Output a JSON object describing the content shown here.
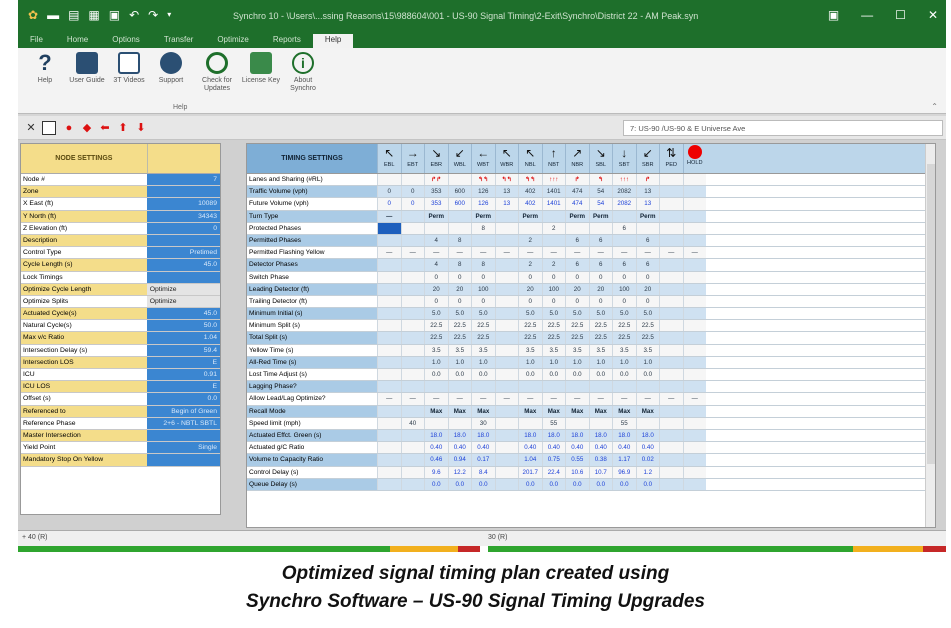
{
  "window": {
    "title": "Synchro 10 - \\Users\\...ssing Reasons\\15\\988604\\001 - US-90 Signal Timing\\2-Exit\\Synchro\\District 22 - AM Peak.syn"
  },
  "ribbon": {
    "tabs": [
      "File",
      "Home",
      "Options",
      "Transfer",
      "Optimize",
      "Reports",
      "Help"
    ],
    "buttons": [
      "Help",
      "User Guide",
      "3T Videos",
      "Support",
      "Check for Updates",
      "License Key",
      "About Synchro"
    ],
    "group_label": "Help"
  },
  "toolbar": {
    "node_selector": "7: US-90 /US-90 & E Universe Ave"
  },
  "node_panel": {
    "header": "NODE SETTINGS",
    "rows": [
      {
        "label": "Node #",
        "value": "7"
      },
      {
        "label": "Zone",
        "value": ""
      },
      {
        "label": "X East (ft)",
        "value": "10089"
      },
      {
        "label": "Y North (ft)",
        "value": "34343"
      },
      {
        "label": "Z Elevation (ft)",
        "value": "0"
      },
      {
        "label": "Description",
        "value": ""
      },
      {
        "label": "Control Type",
        "value": "Pretimed"
      },
      {
        "label": "Cycle Length (s)",
        "value": "45.0"
      },
      {
        "label": "Lock Timings",
        "value": ""
      },
      {
        "label": "Optimize Cycle Length",
        "value": "Optimize"
      },
      {
        "label": "Optimize Splits",
        "value": "Optimize"
      },
      {
        "label": "Actuated Cycle(s)",
        "value": "45.0"
      },
      {
        "label": "Natural Cycle(s)",
        "value": "50.0"
      },
      {
        "label": "Max v/c Ratio",
        "value": "1.04"
      },
      {
        "label": "Intersection Delay (s)",
        "value": "59.4"
      },
      {
        "label": "Intersection LOS",
        "value": "E"
      },
      {
        "label": "ICU",
        "value": "0.91"
      },
      {
        "label": "ICU LOS",
        "value": "E"
      },
      {
        "label": "Offset (s)",
        "value": "0.0"
      },
      {
        "label": "Referenced to",
        "value": "Begin of Green"
      },
      {
        "label": "Reference Phase",
        "value": "2+6 - NBTL SBTL"
      },
      {
        "label": "Master Intersection",
        "value": ""
      },
      {
        "label": "Yield Point",
        "value": "Single"
      },
      {
        "label": "Mandatory Stop On Yellow",
        "value": ""
      }
    ]
  },
  "timing_panel": {
    "header": "TIMING SETTINGS",
    "movements": [
      {
        "label": "EBL",
        "arrow": "↖"
      },
      {
        "label": "EBT",
        "arrow": "→"
      },
      {
        "label": "EBR",
        "arrow": "↘"
      },
      {
        "label": "WBL",
        "arrow": "↙"
      },
      {
        "label": "WBT",
        "arrow": "←"
      },
      {
        "label": "WBR",
        "arrow": "↖"
      },
      {
        "label": "NBL",
        "arrow": "↖"
      },
      {
        "label": "NBT",
        "arrow": "↑"
      },
      {
        "label": "NBR",
        "arrow": "↗"
      },
      {
        "label": "SBL",
        "arrow": "↘"
      },
      {
        "label": "SBT",
        "arrow": "↓"
      },
      {
        "label": "SBR",
        "arrow": "↙"
      },
      {
        "label": "PED",
        "arrow": "⇅"
      },
      {
        "label": "HOLD",
        "arrow": ""
      }
    ],
    "rows": [
      {
        "label": "Lanes and Sharing (#RL)",
        "values": [
          "",
          "",
          "↱↱",
          "",
          "↰↰",
          "↰↰",
          "↰↰",
          "↑↑↑",
          "↱",
          "↰",
          "↑↑↑",
          "↱",
          "",
          ""
        ]
      },
      {
        "label": "Traffic Volume (vph)",
        "values": [
          "0",
          "0",
          "353",
          "600",
          "126",
          "13",
          "402",
          "1401",
          "474",
          "54",
          "2082",
          "13",
          "",
          ""
        ]
      },
      {
        "label": "Future Volume (vph)",
        "values": [
          "0",
          "0",
          "353",
          "600",
          "126",
          "13",
          "402",
          "1401",
          "474",
          "54",
          "2082",
          "13",
          "",
          ""
        ]
      },
      {
        "label": "Turn Type",
        "values": [
          "—",
          "",
          "Perm",
          "",
          "Perm",
          "",
          "Perm",
          "",
          "Perm",
          "Perm",
          "",
          "Perm",
          "",
          ""
        ]
      },
      {
        "label": "Protected Phases",
        "values": [
          "",
          "",
          "",
          "",
          "8",
          "",
          "",
          "2",
          "",
          "",
          "6",
          "",
          "",
          ""
        ]
      },
      {
        "label": "Permitted Phases",
        "values": [
          "",
          "",
          "4",
          "8",
          "",
          "",
          "2",
          "",
          "6",
          "6",
          "",
          "6",
          "",
          ""
        ]
      },
      {
        "label": "Permitted Flashing Yellow",
        "values": [
          "—",
          "—",
          "—",
          "—",
          "—",
          "—",
          "—",
          "—",
          "—",
          "—",
          "—",
          "—",
          "—",
          "—"
        ]
      },
      {
        "label": "Detector Phases",
        "values": [
          "",
          "",
          "4",
          "8",
          "8",
          "",
          "2",
          "2",
          "6",
          "6",
          "6",
          "6",
          "",
          ""
        ]
      },
      {
        "label": "Switch Phase",
        "values": [
          "",
          "",
          "0",
          "0",
          "0",
          "",
          "0",
          "0",
          "0",
          "0",
          "0",
          "0",
          "",
          ""
        ]
      },
      {
        "label": "Leading Detector (ft)",
        "values": [
          "",
          "",
          "20",
          "20",
          "100",
          "",
          "20",
          "100",
          "20",
          "20",
          "100",
          "20",
          "",
          ""
        ]
      },
      {
        "label": "Trailing Detector (ft)",
        "values": [
          "",
          "",
          "0",
          "0",
          "0",
          "",
          "0",
          "0",
          "0",
          "0",
          "0",
          "0",
          "",
          ""
        ]
      },
      {
        "label": "Minimum Initial (s)",
        "values": [
          "",
          "",
          "5.0",
          "5.0",
          "5.0",
          "",
          "5.0",
          "5.0",
          "5.0",
          "5.0",
          "5.0",
          "5.0",
          "",
          ""
        ]
      },
      {
        "label": "Minimum Split (s)",
        "values": [
          "",
          "",
          "22.5",
          "22.5",
          "22.5",
          "",
          "22.5",
          "22.5",
          "22.5",
          "22.5",
          "22.5",
          "22.5",
          "",
          ""
        ]
      },
      {
        "label": "Total Split (s)",
        "values": [
          "",
          "",
          "22.5",
          "22.5",
          "22.5",
          "",
          "22.5",
          "22.5",
          "22.5",
          "22.5",
          "22.5",
          "22.5",
          "",
          ""
        ]
      },
      {
        "label": "Yellow Time (s)",
        "values": [
          "",
          "",
          "3.5",
          "3.5",
          "3.5",
          "",
          "3.5",
          "3.5",
          "3.5",
          "3.5",
          "3.5",
          "3.5",
          "",
          ""
        ]
      },
      {
        "label": "All-Red Time (s)",
        "values": [
          "",
          "",
          "1.0",
          "1.0",
          "1.0",
          "",
          "1.0",
          "1.0",
          "1.0",
          "1.0",
          "1.0",
          "1.0",
          "",
          ""
        ]
      },
      {
        "label": "Lost Time Adjust (s)",
        "values": [
          "",
          "",
          "0.0",
          "0.0",
          "0.0",
          "",
          "0.0",
          "0.0",
          "0.0",
          "0.0",
          "0.0",
          "0.0",
          "",
          ""
        ]
      },
      {
        "label": "Lagging Phase?",
        "values": [
          "",
          "",
          "",
          "",
          "",
          "",
          "",
          "",
          "",
          "",
          "",
          "",
          "",
          ""
        ]
      },
      {
        "label": "Allow Lead/Lag Optimize?",
        "values": [
          "—",
          "—",
          "—",
          "—",
          "—",
          "—",
          "—",
          "—",
          "—",
          "—",
          "—",
          "—",
          "—",
          "—"
        ]
      },
      {
        "label": "Recall Mode",
        "values": [
          "",
          "",
          "Max",
          "Max",
          "Max",
          "",
          "Max",
          "Max",
          "Max",
          "Max",
          "Max",
          "Max",
          "",
          ""
        ]
      },
      {
        "label": "Speed limit (mph)",
        "values": [
          "",
          "40",
          "",
          "",
          "30",
          "",
          "",
          "55",
          "",
          "",
          "55",
          "",
          "",
          ""
        ]
      },
      {
        "label": "Actuated Effct. Green (s)",
        "values": [
          "",
          "",
          "18.0",
          "18.0",
          "18.0",
          "",
          "18.0",
          "18.0",
          "18.0",
          "18.0",
          "18.0",
          "18.0",
          "",
          ""
        ]
      },
      {
        "label": "Actuated g/C Ratio",
        "values": [
          "",
          "",
          "0.40",
          "0.40",
          "0.40",
          "",
          "0.40",
          "0.40",
          "0.40",
          "0.40",
          "0.40",
          "0.40",
          "",
          ""
        ]
      },
      {
        "label": "Volume to Capacity Ratio",
        "values": [
          "",
          "",
          "0.46",
          "0.94",
          "0.17",
          "",
          "1.04",
          "0.75",
          "0.55",
          "0.38",
          "1.17",
          "0.02",
          "",
          ""
        ]
      },
      {
        "label": "Control Delay (s)",
        "values": [
          "",
          "",
          "9.6",
          "12.2",
          "8.4",
          "",
          "201.7",
          "22.4",
          "10.6",
          "10.7",
          "96.9",
          "1.2",
          "",
          ""
        ]
      },
      {
        "label": "Queue Delay (s)",
        "values": [
          "",
          "",
          "0.0",
          "0.0",
          "0.0",
          "",
          "0.0",
          "0.0",
          "0.0",
          "0.0",
          "0.0",
          "0.0",
          "",
          ""
        ]
      }
    ]
  },
  "bottom": {
    "left_label": "+ 40 (R)",
    "right_label": "30 (R)"
  },
  "caption": {
    "line1": "Optimized signal timing plan created using",
    "line2": "Synchro Software – US-90 Signal Timing Upgrades"
  }
}
